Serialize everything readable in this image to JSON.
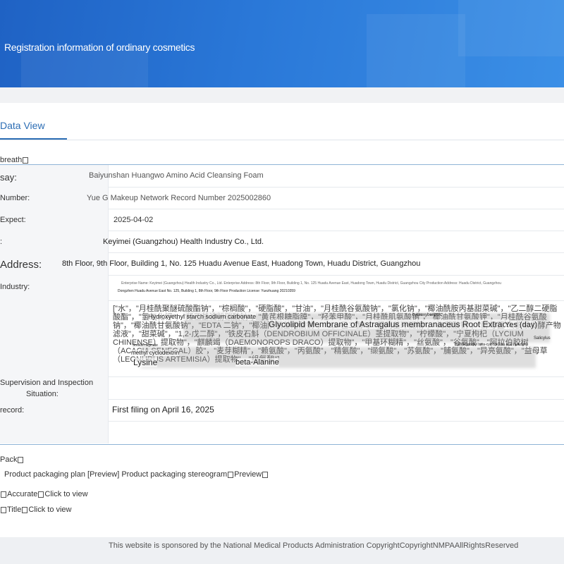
{
  "header": {
    "title": "Registration information of ordinary cosmetics"
  },
  "tabs": {
    "active": "Data View"
  },
  "section": {
    "label": "breath"
  },
  "record": {
    "rows": {
      "say": {
        "label": "say:",
        "value": "Baiyunshan Huangwo Amino Acid Cleansing Foam"
      },
      "number": {
        "label": "Number:",
        "value": "Yue G Makeup Network Record Number 2025002860"
      },
      "expect": {
        "label": "Expect:",
        "value": "2025-04-02"
      },
      "company": {
        "label": ":",
        "value": "Keyimei (Guangzhou) Health Industry Co., Ltd."
      },
      "address": {
        "label": "Address:",
        "value": "8th Floor, 9th Floor, Building 1, No. 125 Huadu Avenue East, Huadong Town, Huadu District, Guangzhou"
      },
      "industry": {
        "label": "Industry:",
        "value_line1": "Enterprise Name: Keyimei (Guangzhou) Health Industry Co., Ltd. Enterprise Address: 8th Floor, 9th Floor, Building 1, No. 125 Huadu Avenue East, Huadong Town, Huadu District, Guangzhou City Production Address: Huadu District, Guangzhou",
        "value_line2": "Dongzhen Huadu Avenue East No. 125, Building 1, 8th Floor, 9th Floor Production License: Yuezhuang 20210359"
      },
      "ingredients": {
        "text": "[\"水\"，\"月桂酰聚醚硫酸酯钠\"，\"棕榈酸\"，\"硬脂酸\"，\"甘油\"，\"月桂酰谷氨酸钠\"，\"氯化钠\"，\"椰油酰胺丙基甜菜碱\"，\"乙二醇二硬脂酸酯\"，\"氢氧化钾\"，\"羟乙基淀粉碳酸钠\"，\"黄芪根糖脂膜\"，\"羟苯甲酸\"，\"月桂酰肌氨酸钠\"，\"椰油酰甘氨酸钾\"，\"月桂酰谷氨酸钠\"，\"椰油酰甘氨酸钠\"，\"EDTA 二钠\"，\"椰油酰氨基丙酸钠\"，\"1,2-己二醇\"，\"羟丙基环糊精\"，\"海藻酸钠\"，\"酵母菌/人参根发酵产物滤液\"，\"甜菜碱\"，\"1,2-戊二醇\"，\"铁皮石斛（DENDROBIUM OFFICINALE）茎提取物\"，\"柠檬酸\"，\"宁夏枸杞（LYCIUM CHINENSE）提取物\"，\"麒麟竭（DAEMONOROPS DRACO）提取物\"，\"甲基环糊精\"，\"丝氨酸\"，\"谷氨酸\"，\"阿拉伯胶树（ACACIA SENEGAL）胶\"，\"麦芽糊精\"，\"赖氨酸\"，\"丙氨酸\"，\"精氨酸\"，\"缬氨酸\"，\"苏氨酸\"，\"脯氨酸\"，\"异亮氨酸\"，\"益母草（LEONURUS ARTEMISIA）提取物\"，\"组氨酸\"]",
        "overlays": {
          "o1": "Hydroxyethyl starch sodium carbonate",
          "o2": "Glycolipid Membrane of Astragalus membranaceus Root Extract",
          "o3": "hydroxybenzoic",
          "o4": "Yes (day)",
          "o5": "Salicylus",
          "o6": "Sodium alginate",
          "o7": "Hydroxypropyl beta-cyclodextrin acid hydrogen",
          "o8": "methyl cyclodextrin",
          "o9": "Lysine",
          "o10": "beta-Alanine"
        }
      },
      "supervision": {
        "label_line1": "Supervision and Inspection",
        "label_line2": "Situation:",
        "value": ""
      },
      "filing": {
        "label": "record:",
        "value": "First filing on April 16, 2025"
      },
      "empty": {
        "label": "",
        "value": ""
      }
    }
  },
  "packaging": {
    "heading": "Pack",
    "links_line": "Product packaging plan [Preview] Product packaging stereogram",
    "preview_link": "Preview",
    "accurate_label": "Accurate",
    "accurate_link": "Click to view",
    "title_label": "Title",
    "title_link": "Click to view"
  },
  "footer": {
    "text": "This website is sponsored by the National Medical Products Administration CopyrightCopyrightNMPAAllRightsReserved"
  }
}
